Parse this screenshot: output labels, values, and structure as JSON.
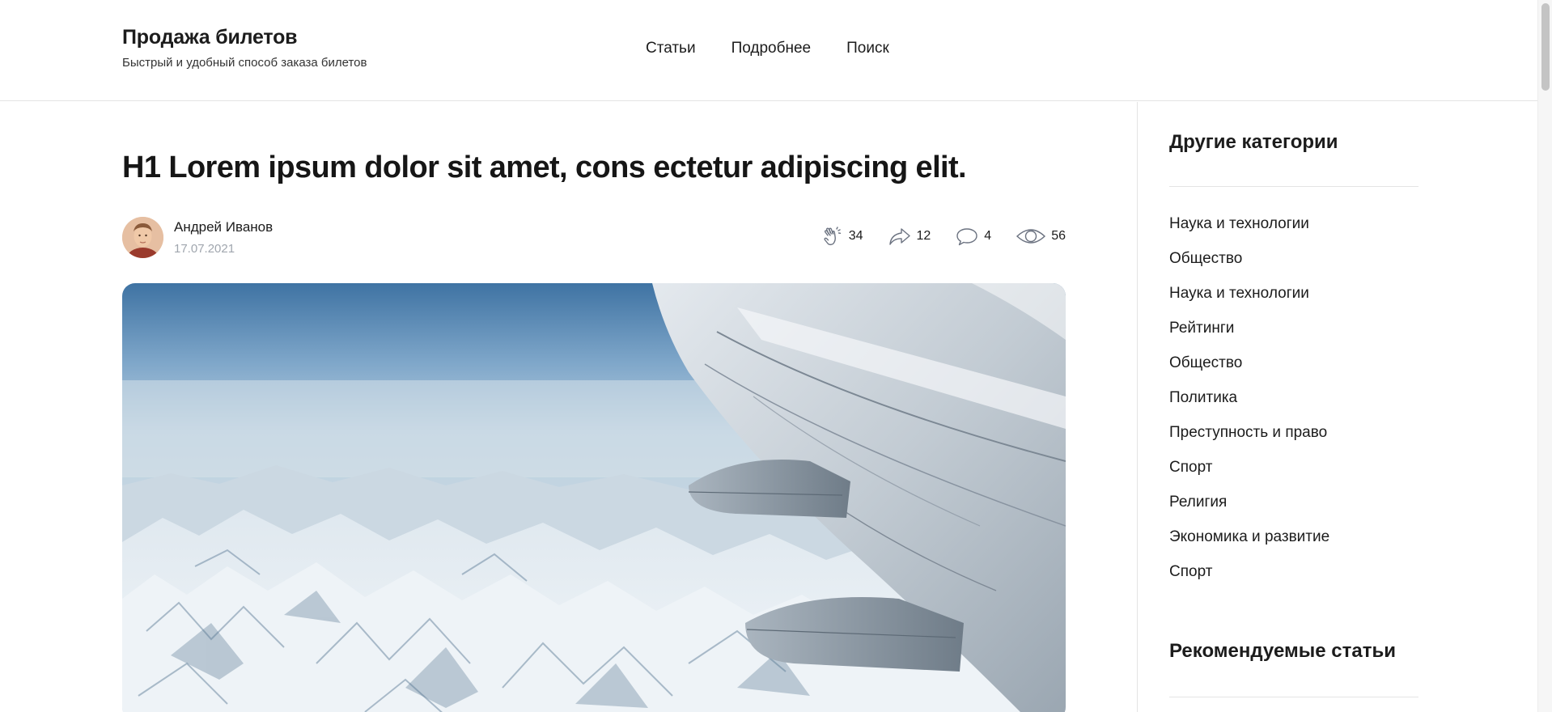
{
  "header": {
    "brand_title": "Продажа билетов",
    "brand_subtitle": "Быстрый и удобный способ заказа билетов",
    "nav": [
      "Статьи",
      "Подробнее",
      "Поиск"
    ]
  },
  "article": {
    "title": "H1 Lorem ipsum dolor sit amet, cons ectetur adipiscing elit.",
    "author": {
      "name": "Андрей Иванов",
      "date": "17.07.2021",
      "avatar_icon": "user-avatar"
    },
    "stats": {
      "claps": {
        "icon": "clap-icon",
        "value": "34"
      },
      "shares": {
        "icon": "share-icon",
        "value": "12"
      },
      "comments": {
        "icon": "comment-icon",
        "value": "4"
      },
      "views": {
        "icon": "eye-icon",
        "value": "56"
      }
    },
    "hero_image": {
      "description_icon": "airplane-wing-over-mountains-image"
    }
  },
  "sidebar": {
    "categories_title": "Другие категории",
    "categories": [
      "Наука и технологии",
      "Общество",
      "Наука и технологии",
      "Рейтинги",
      "Общество",
      "Политика",
      "Преступность и право",
      "Спорт",
      "Религия",
      "Экономика и развитие",
      "Спорт"
    ],
    "recommended_title": "Рекомендуемые статьи"
  },
  "colors": {
    "text": "#1c1c1c",
    "muted": "#a0a6ae",
    "divider": "#e4e4e4",
    "background": "#ffffff"
  }
}
